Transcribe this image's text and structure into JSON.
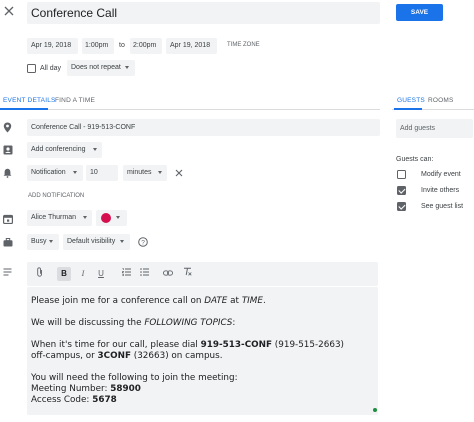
{
  "header": {
    "title": "Conference Call",
    "save_label": "SAVE"
  },
  "datetime": {
    "start_date": "Apr 19, 2018",
    "start_time": "1:00pm",
    "to": "to",
    "end_time": "2:00pm",
    "end_date": "Apr 19, 2018",
    "time_zone": "TIME ZONE",
    "all_day": "All day",
    "repeat": "Does not repeat"
  },
  "tabs": {
    "event_details": "EVENT DETAILS",
    "find_time": "FIND A TIME",
    "guests": "GUESTS",
    "rooms": "ROOMS"
  },
  "details": {
    "location": "Conference Call - 919-513-CONF",
    "conferencing": "Add conferencing",
    "notification_type": "Notification",
    "notification_value": "10",
    "notification_unit": "minutes",
    "add_notification": "ADD NOTIFICATION",
    "calendar_owner": "Alice Thurman",
    "calendar_color": "#d50f4d",
    "busy": "Busy",
    "visibility": "Default visibility"
  },
  "guests": {
    "placeholder": "Add guests",
    "can_label": "Guests can:",
    "permissions": [
      {
        "label": "Modify event",
        "checked": false
      },
      {
        "label": "Invite others",
        "checked": true
      },
      {
        "label": "See guest list",
        "checked": true
      }
    ]
  },
  "description": {
    "l1a": "Please join me for a conference call on ",
    "l1b": "DATE",
    "l1c": " at ",
    "l1d": "TIME",
    "l1e": ".",
    "l2a": "We will be discussing the ",
    "l2b": "FOLLOWING TOPICS",
    "l2c": ":",
    "l3a": "When it's time for our call, please dial ",
    "l3b": "919-513-CONF",
    "l3c": " (919-515-2663)",
    "l4a": "off-campus, or ",
    "l4b": "3CONF",
    "l4c": " (32663) on campus.",
    "l5": "You will need the following to join the meeting:",
    "l6a": "Meeting Number: ",
    "l6b": "58900",
    "l7a": "Access Code: ",
    "l7b": "5678"
  }
}
